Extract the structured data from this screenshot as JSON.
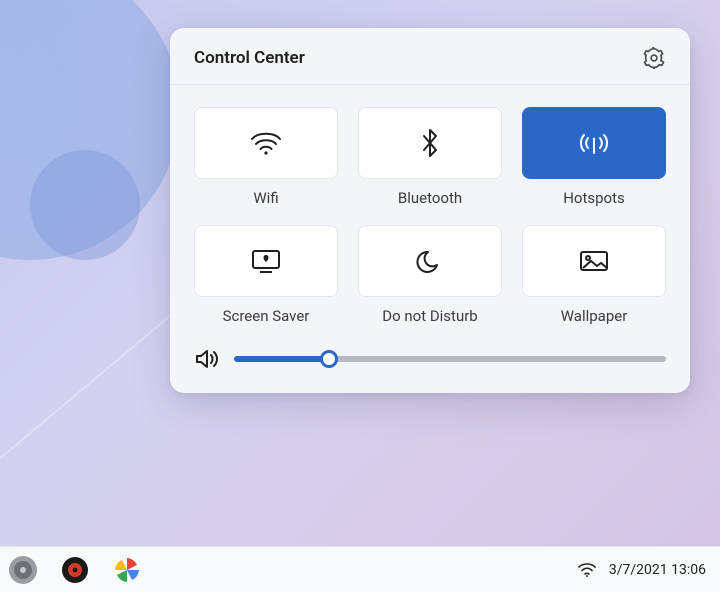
{
  "panel": {
    "title": "Control Center"
  },
  "tiles": [
    {
      "id": "wifi",
      "label": "Wifi",
      "active": false
    },
    {
      "id": "bluetooth",
      "label": "Bluetooth",
      "active": false
    },
    {
      "id": "hotspots",
      "label": "Hotspots",
      "active": true
    },
    {
      "id": "screensaver",
      "label": "Screen Saver",
      "active": false
    },
    {
      "id": "dnd",
      "label": "Do not Disturb",
      "active": false
    },
    {
      "id": "wallpaper",
      "label": "Wallpaper",
      "active": false
    }
  ],
  "volume": {
    "percent": 22
  },
  "taskbar": {
    "datetime": "3/7/2021 13:06"
  },
  "colors": {
    "accent": "#2a68c8"
  }
}
